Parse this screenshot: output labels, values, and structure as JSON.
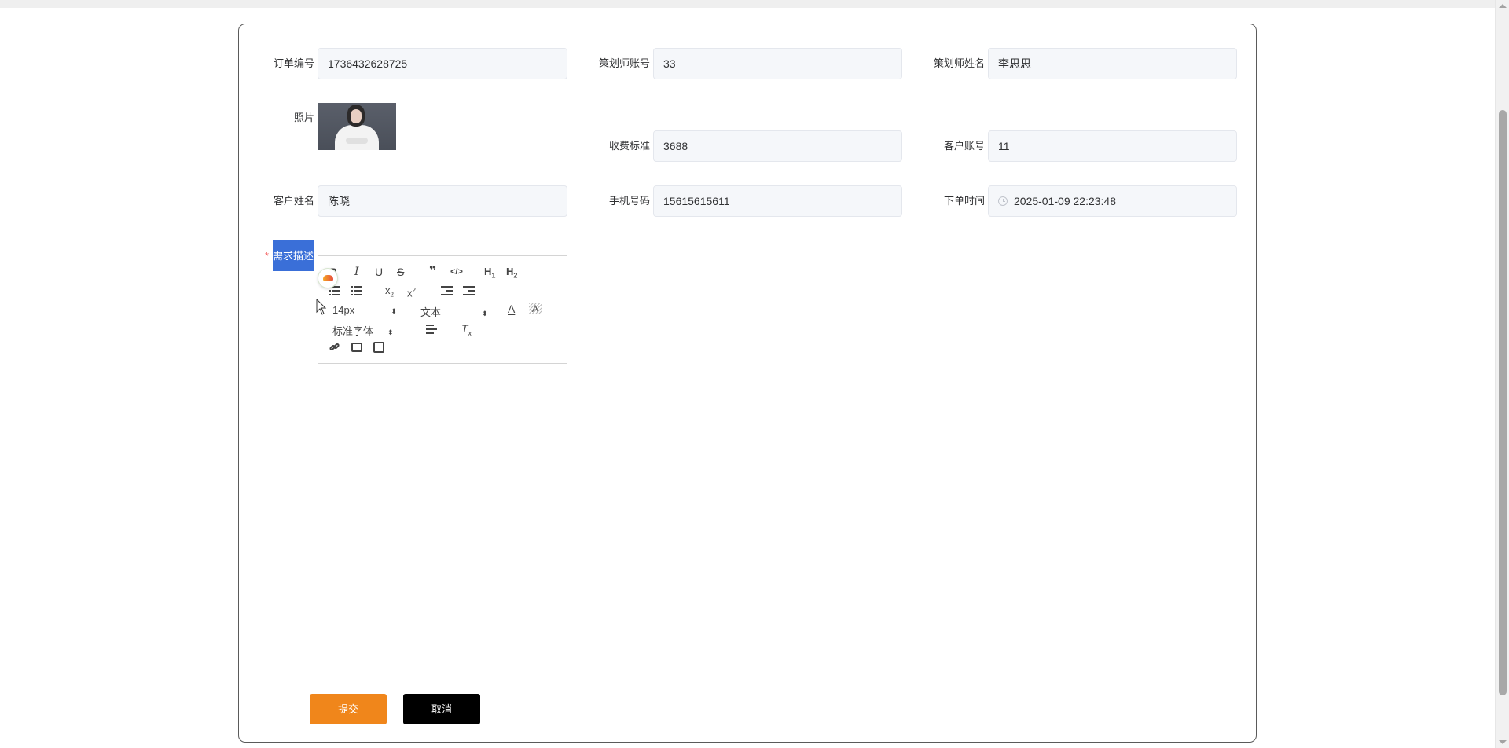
{
  "form": {
    "order_no": {
      "label": "订单编号",
      "value": "1736432628725"
    },
    "planner_account": {
      "label": "策划师账号",
      "value": "33"
    },
    "planner_name": {
      "label": "策划师姓名",
      "value": "李思思"
    },
    "photo": {
      "label": "照片"
    },
    "fee_standard": {
      "label": "收费标准",
      "value": "3688"
    },
    "customer_account": {
      "label": "客户账号",
      "value": "11"
    },
    "customer_name": {
      "label": "客户姓名",
      "value": "陈晓"
    },
    "phone": {
      "label": "手机号码",
      "value": "15615615611"
    },
    "order_time": {
      "label": "下单时间",
      "value": "2025-01-09 22:23:48"
    },
    "description": {
      "label": "需求描述",
      "required_mark": "*"
    }
  },
  "editor": {
    "font_size_value": "14px",
    "header_value": "文本",
    "font_family_value": "标准字体",
    "content": ""
  },
  "buttons": {
    "submit_label": "提交",
    "cancel_label": "取消"
  },
  "colors": {
    "submit_bg": "#f0861b",
    "cancel_bg": "#000000",
    "label_highlight_bg": "#3a6fd8",
    "required": "#f56c6c"
  }
}
